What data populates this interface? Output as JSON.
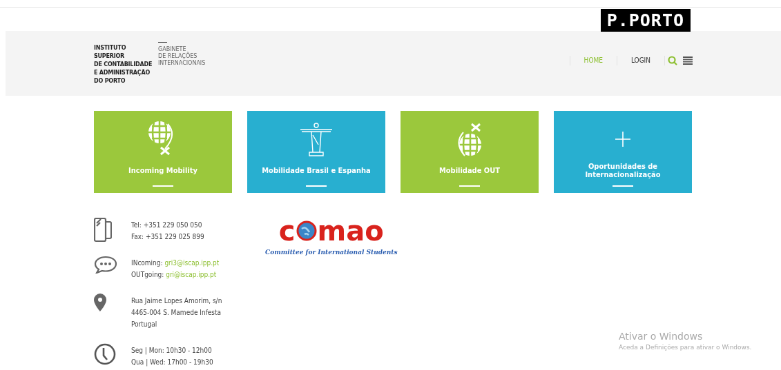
{
  "top_logo": "P.PORTO",
  "header": {
    "institute": [
      "INSTITUTO",
      "SUPERIOR",
      "DE CONTABILIDADE",
      "E ADMINISTRAÇÃO",
      "DO PORTO"
    ],
    "department": [
      "GABINETE",
      "DE RELAÇÕES",
      "INTERNACIONAIS"
    ],
    "nav": [
      {
        "label": "HOME",
        "selected": true
      },
      {
        "label": "LOGIN",
        "selected": false
      }
    ]
  },
  "tiles": [
    {
      "label": "Incoming Mobility",
      "kind": "globe-in",
      "color": "#9bc83c"
    },
    {
      "label": "Mobilidade Brasil e Espanha",
      "kind": "statue",
      "color": "#28afd0"
    },
    {
      "label": "Mobilidade OUT",
      "kind": "globe-out",
      "color": "#9bc83c"
    },
    {
      "label": "Oportunidades de Internacionalização",
      "kind": "plus",
      "color": "#28afd0"
    }
  ],
  "contacts": [
    {
      "kind": "phone",
      "lines": [
        {
          "text": "Tel: +351 229 050 050"
        },
        {
          "text": "Fax: +351 229 025 899"
        }
      ]
    },
    {
      "kind": "chat",
      "lines": [
        {
          "text": "INcoming:",
          "link": "gri3@iscap.ipp.pt"
        },
        {
          "text": "OUTgoing:",
          "link": "gri@iscap.ipp.pt"
        }
      ]
    },
    {
      "kind": "pin",
      "lines": [
        {
          "text": "Rua Jaime Lopes Amorim, s/n"
        },
        {
          "text": "4465-004 S. Mamede Infesta"
        },
        {
          "text": "Portugal"
        }
      ]
    },
    {
      "kind": "clock",
      "lines": [
        {
          "text": "Seg | Mon: 10h30 - 12h00"
        },
        {
          "text": "Qua | Wed: 17h00 - 19h30"
        }
      ]
    }
  ],
  "partner_logo": {
    "wordmark": [
      "c",
      "mao"
    ],
    "tagline": "Committee for International Students"
  },
  "windows_notice": {
    "title": "Ativar o Windows",
    "text": "Aceda a Definições para ativar o Windows."
  }
}
